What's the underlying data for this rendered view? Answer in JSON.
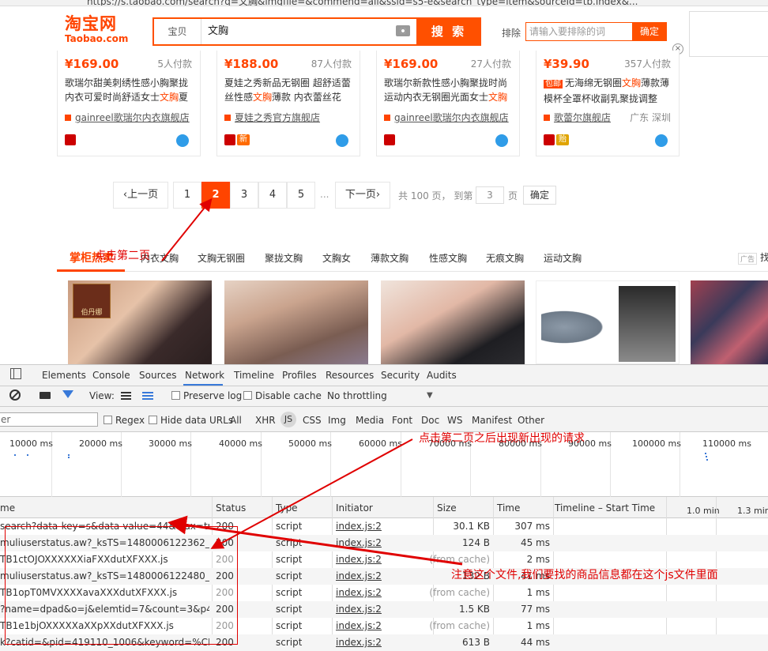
{
  "browser": {
    "url": "https://s.taobao.com/search?q=文胸&imgfile=&commend=all&ssid=s5-e&search_type=item&sourceId=tb.index&..."
  },
  "header": {
    "logo_cn": "淘宝网",
    "logo_en": "Taobao.com",
    "search_category": "宝贝",
    "search_query": "文胸",
    "search_button": "搜 索",
    "exclude_label": "排除",
    "exclude_placeholder": "请输入要排除的词",
    "exclude_button": "确定",
    "close_symbol": "×"
  },
  "products": [
    {
      "price": "¥169.00",
      "sold": "5人付款",
      "title_pre": "歌瑞尔甜美刺绣性感小胸聚拢内衣可爱时尚舒适女士",
      "keyword": "文胸",
      "title_post": "夏",
      "tag": "",
      "shop": "gainreel歌瑞尔内衣旗舰店",
      "location": "",
      "badge2": ""
    },
    {
      "price": "¥188.00",
      "sold": "87人付款",
      "title_pre": "夏娃之秀新品无钢圈 超舒适蕾丝性感",
      "keyword": "文胸",
      "title_post": "薄款 内衣蕾丝花",
      "tag": "",
      "shop": "夏娃之秀官方旗舰店",
      "location": "",
      "badge2": "新"
    },
    {
      "price": "¥169.00",
      "sold": "27人付款",
      "title_pre": "歌瑞尔新款性感小胸聚拢时尚运动内衣无钢圈光面女士",
      "keyword": "文胸",
      "title_post": "",
      "tag": "",
      "shop": "gainreel歌瑞尔内衣旗舰店",
      "location": "",
      "badge2": ""
    },
    {
      "price": "¥39.90",
      "sold": "357人付款",
      "title_pre": "无海绵无钢圈",
      "keyword": "文胸",
      "title_post": "薄款薄模杯全罩杯收副乳聚拢调整",
      "tag": "包邮",
      "shop": "歌蕾尔旗舰店",
      "location": "广东 深圳",
      "badge2": "贻"
    }
  ],
  "pagination": {
    "prev": "上一页",
    "pages": [
      "1",
      "2",
      "3",
      "4",
      "5"
    ],
    "current": "2",
    "dots": "...",
    "next": "下一页",
    "info": "共 100 页， 到第",
    "jump_value": "3",
    "page_unit": "页",
    "confirm": "确定"
  },
  "hot": {
    "title": "掌柜热卖",
    "links": [
      "内衣文胸",
      "文胸无钢圈",
      "聚拢文胸",
      "文胸女",
      "薄款文胸",
      "性感文胸",
      "无痕文胸",
      "运动文胸"
    ],
    "ad_tag": "广告",
    "more": "找",
    "brand_label": "伯丹娜"
  },
  "devtools": {
    "tabs": [
      "Elements",
      "Console",
      "Sources",
      "Network",
      "Timeline",
      "Profiles",
      "Resources",
      "Security",
      "Audits"
    ],
    "active_tab": "Network",
    "toolbar": {
      "view_label": "View:",
      "preserve_log": "Preserve log",
      "disable_cache": "Disable cache",
      "throttling": "No throttling"
    },
    "filter": {
      "placeholder": "er",
      "regex": "Regex",
      "hide_data_urls": "Hide data URLs",
      "types": [
        "All",
        "XHR",
        "JS",
        "CSS",
        "Img",
        "Media",
        "Font",
        "Doc",
        "WS",
        "Manifest",
        "Other"
      ]
    },
    "overview_ticks": [
      "10000 ms",
      "20000 ms",
      "30000 ms",
      "40000 ms",
      "50000 ms",
      "60000 ms",
      "70000 ms",
      "80000 ms",
      "90000 ms",
      "100000 ms",
      "110000 ms"
    ],
    "columns": [
      "me",
      "Status",
      "Type",
      "Initiator",
      "Size",
      "Time",
      "Timeline – Start Time",
      "1.0 min",
      "1.3 min"
    ],
    "rows": [
      {
        "name": "search?data-key=s&data-value=44&ajax=true&...",
        "status": "200",
        "type": "script",
        "initiator": "index.js:2",
        "size": "30.1 KB",
        "time": "307 ms"
      },
      {
        "name": "muliuserstatus.aw?_ksTS=1480006122362_925&...",
        "status": "200",
        "type": "script",
        "initiator": "index.js:2",
        "size": "124 B",
        "time": "45 ms"
      },
      {
        "name": "TB1ctOJOXXXXXXiaFXXdutXFXXX.js",
        "status": "200",
        "type": "script",
        "initiator": "index.js:2",
        "size": "(from cache)",
        "time": "2 ms"
      },
      {
        "name": "muliuserstatus.aw?_ksTS=1480006122480_997&...",
        "status": "200",
        "type": "script",
        "initiator": "index.js:2",
        "size": "132 B",
        "time": "41 ms"
      },
      {
        "name": "TB1opT0MVXXXXavaXXXdutXFXXX.js",
        "status": "200",
        "type": "script",
        "initiator": "index.js:2",
        "size": "(from cache)",
        "time": "1 ms"
      },
      {
        "name": "?name=dpad&o=j&elemtid=7&count=3&p4p=...",
        "status": "200",
        "type": "script",
        "initiator": "index.js:2",
        "size": "1.5 KB",
        "time": "77 ms"
      },
      {
        "name": "TB1e1bjOXXXXXaXXpXXdutXFXXX.js",
        "status": "200",
        "type": "script",
        "initiator": "index.js:2",
        "size": "(from cache)",
        "time": "1 ms"
      },
      {
        "name": "k?catid=&pid=419110_1006&keyword=%CE%C...",
        "status": "200",
        "type": "script",
        "initiator": "index.js:2",
        "size": "613 B",
        "time": "44 ms"
      }
    ]
  },
  "annotations": {
    "click_page2": "点击第二页",
    "new_request": "点击第二页之后出现新出现的请求",
    "note_file": "注意这个文件,我们要找的商品信息都在这个js文件里面"
  },
  "colors": {
    "accent": "#ff4400",
    "annotation": "#e00000",
    "devtools_blue": "#3879d9"
  }
}
